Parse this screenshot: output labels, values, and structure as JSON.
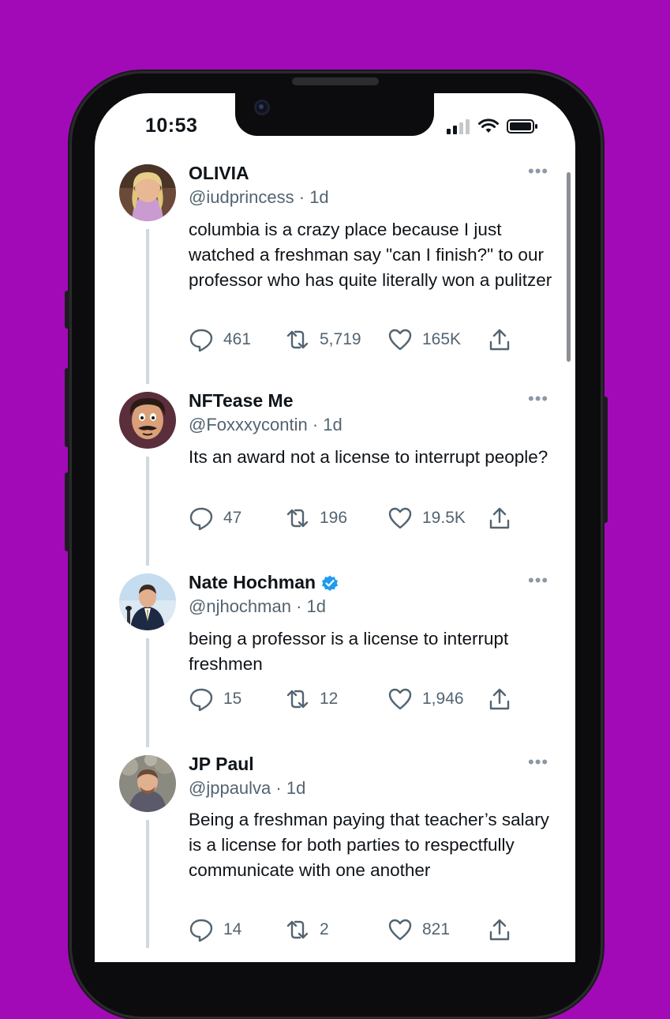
{
  "status_bar": {
    "time": "10:53"
  },
  "tweets": [
    {
      "name": "OLIVIA",
      "handle": "@iudprincess",
      "time": "1d",
      "text": "columbia is a crazy place because I just watched a freshman say \"can I finish?\" to our professor who has quite literally won a pulitzer",
      "replies": "461",
      "retweets": "5,719",
      "likes": "165K",
      "verified": false
    },
    {
      "name": "NFTease Me",
      "handle": "@Foxxxycontin",
      "time": "1d",
      "text": "Its an award not a license to interrupt people?",
      "replies": "47",
      "retweets": "196",
      "likes": "19.5K",
      "verified": false
    },
    {
      "name": "Nate Hochman",
      "handle": "@njhochman",
      "time": "1d",
      "text": "being a professor is a license to interrupt freshmen",
      "replies": "15",
      "retweets": "12",
      "likes": "1,946",
      "verified": true
    },
    {
      "name": "JP Paul",
      "handle": "@jppaulva",
      "time": "1d",
      "text": "Being a freshman paying that teacher’s salary is a license for both parties to respectfully communicate with one another",
      "replies": "14",
      "retweets": "2",
      "likes": "821",
      "verified": false
    }
  ],
  "colors": {
    "background": "#a20ab8",
    "verified": "#1d9bf0",
    "muted": "#536471"
  }
}
